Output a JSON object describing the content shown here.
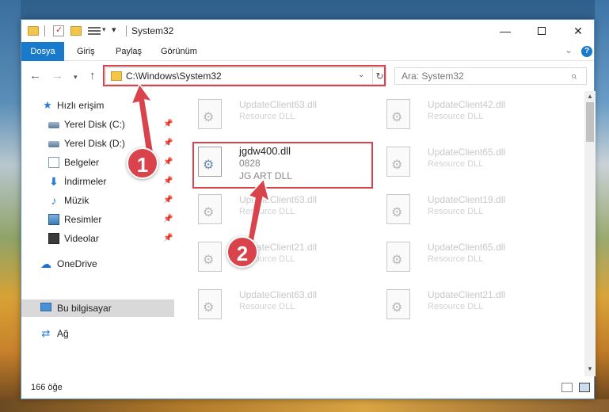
{
  "window": {
    "title": "System32"
  },
  "ribbon": {
    "tabs": [
      {
        "label": "Dosya"
      },
      {
        "label": "Giriş"
      },
      {
        "label": "Paylaş"
      },
      {
        "label": "Görünüm"
      }
    ]
  },
  "navbar": {
    "address": "C:\\Windows\\System32",
    "search_placeholder": "Ara: System32"
  },
  "navpane": {
    "quick_access": "Hızlı erişim",
    "items": [
      {
        "label": "Yerel Disk (C:)",
        "pinned": true
      },
      {
        "label": "Yerel Disk (D:)",
        "pinned": true
      },
      {
        "label": "Belgeler",
        "pinned": true
      },
      {
        "label": "İndirmeler",
        "pinned": true
      },
      {
        "label": "Müzik",
        "pinned": true
      },
      {
        "label": "Resimler",
        "pinned": true
      },
      {
        "label": "Videolar",
        "pinned": true
      }
    ],
    "onedrive": "OneDrive",
    "this_pc": "Bu bilgisayar",
    "network": "Ağ"
  },
  "files": [
    {
      "name": "UpdateClient63.dll",
      "desc": "Resource DLL"
    },
    {
      "name": "UpdateClient42.dll",
      "desc": "Resource DLL"
    },
    {
      "name": "jgdw400.dll",
      "desc": "0828",
      "desc2": "JG ART DLL"
    },
    {
      "name": "UpdateClient65.dll",
      "desc": "Resource DLL"
    },
    {
      "name": "UpdateClient63.dll",
      "desc": "Resource DLL"
    },
    {
      "name": "UpdateClient19.dll",
      "desc": "Resource DLL"
    },
    {
      "name": "UpdateClient21.dll",
      "desc": "Resource DLL"
    },
    {
      "name": "UpdateClient65.dll",
      "desc": "Resource DLL"
    },
    {
      "name": "UpdateClient63.dll",
      "desc": "Resource DLL"
    },
    {
      "name": "UpdateClient21.dll",
      "desc": "Resource DLL"
    }
  ],
  "status": {
    "item_count": "166 öğe"
  },
  "annotations": {
    "step1": "1",
    "step2": "2",
    "color": "#d9434b"
  },
  "icons": {
    "quick_access": "star-icon",
    "disk": "disk-icon",
    "documents": "document-icon",
    "downloads": "download-icon",
    "music": "music-note-icon",
    "pictures": "picture-icon",
    "videos": "video-icon",
    "onedrive": "cloud-icon",
    "this_pc": "computer-icon",
    "network": "network-icon",
    "dll": "dll-file-icon"
  },
  "colors": {
    "accent": "#1979ca",
    "highlight": "#d9434b"
  }
}
